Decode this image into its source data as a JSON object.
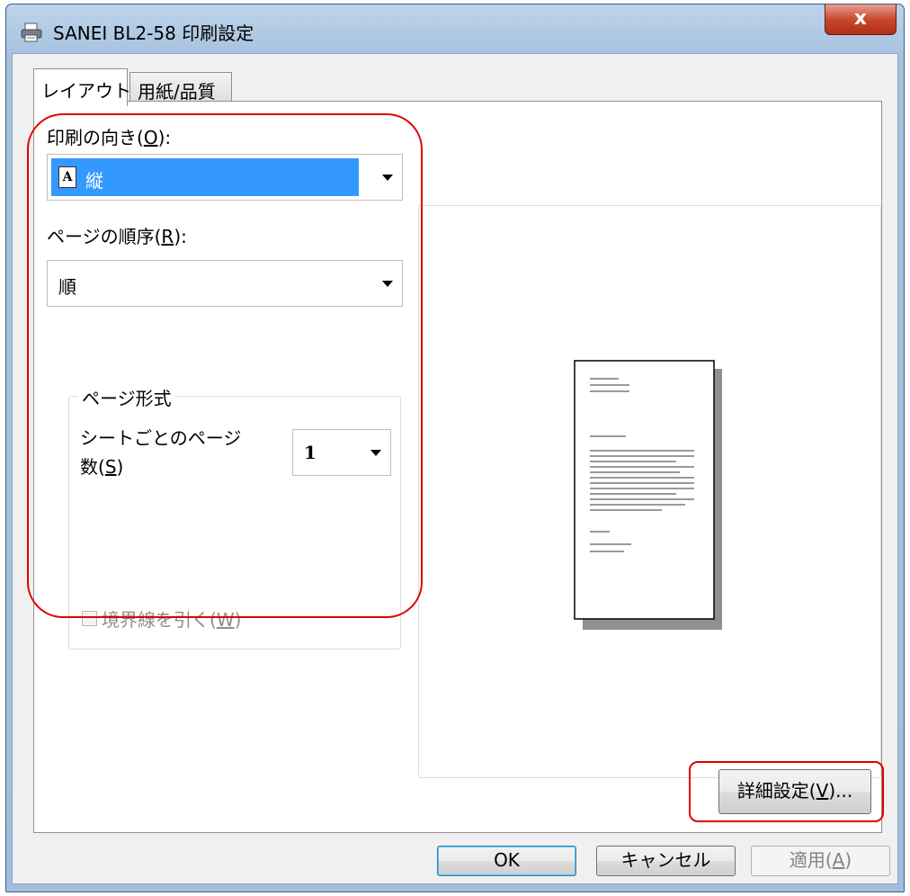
{
  "window": {
    "title": "SANEI BL2-58 印刷設定",
    "close_glyph": "x"
  },
  "tabs": [
    {
      "label": "レイアウト",
      "active": true
    },
    {
      "label": "用紙/品質",
      "active": false
    }
  ],
  "orientation": {
    "label": "印刷の向き(",
    "mnemonic": "O",
    "label_end": "):",
    "value": "縦",
    "icon_letter": "A"
  },
  "page_order": {
    "label": "ページの順序(",
    "mnemonic": "R",
    "label_end": "):",
    "value": "順"
  },
  "page_format": {
    "group_title": "ページ形式",
    "pages_per_sheet_label_line1": "シートごとのページ",
    "pages_per_sheet_label_line2": "数(",
    "pages_per_sheet_mnemonic": "S",
    "pages_per_sheet_label_end": ")",
    "pages_per_sheet_value": "1",
    "draw_borders_label": "境界線を引く(",
    "draw_borders_mnemonic": "W",
    "draw_borders_label_end": ")",
    "draw_borders_checked": false,
    "draw_borders_enabled": false
  },
  "advanced_button": {
    "label": "詳細設定(",
    "mnemonic": "V",
    "label_end": ")..."
  },
  "footer": {
    "ok_label": "OK",
    "cancel_label": "キャンセル",
    "apply_label": "適用(",
    "apply_mnemonic": "A",
    "apply_label_end": ")"
  },
  "colors": {
    "highlight": "#3399ff",
    "annotation": "#e00000",
    "close_button": "#c8492e"
  }
}
